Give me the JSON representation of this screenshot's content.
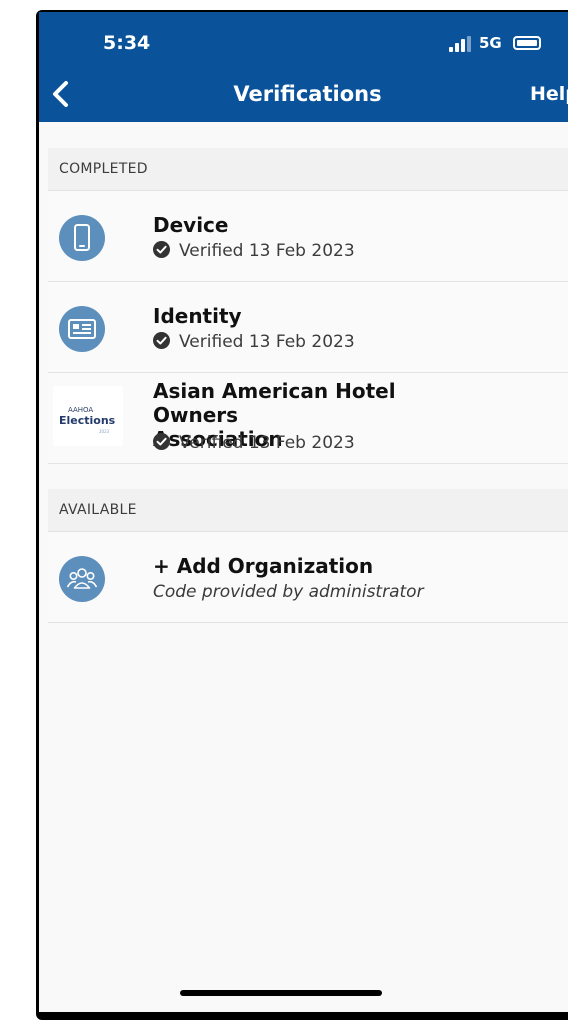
{
  "status_bar": {
    "time": "5:34",
    "network": "5G"
  },
  "header": {
    "title": "Verifications",
    "help_label": "Help"
  },
  "sections": {
    "completed": {
      "label": "COMPLETED"
    },
    "available": {
      "label": "AVAILABLE"
    }
  },
  "completed_items": [
    {
      "name": "Device",
      "icon": "phone-icon",
      "status": "Verified 13 Feb 2023"
    },
    {
      "name": "Identity",
      "icon": "id-card-icon",
      "status": "Verified 13 Feb 2023"
    },
    {
      "name_line1": "Asian American Hotel Owners",
      "name_line2": "Association",
      "logo_top": "AAHOA",
      "logo_main": "Elections",
      "logo_year": "2023",
      "status": "Verified 13 Feb 2023"
    }
  ],
  "available_items": [
    {
      "name": "+ Add Organization",
      "icon": "group-icon",
      "subtitle": "Code provided by administrator"
    }
  ],
  "colors": {
    "header_bg": "#0a539b",
    "icon_bg": "#5d8fbd",
    "page_bg": "#f9f9f9"
  }
}
